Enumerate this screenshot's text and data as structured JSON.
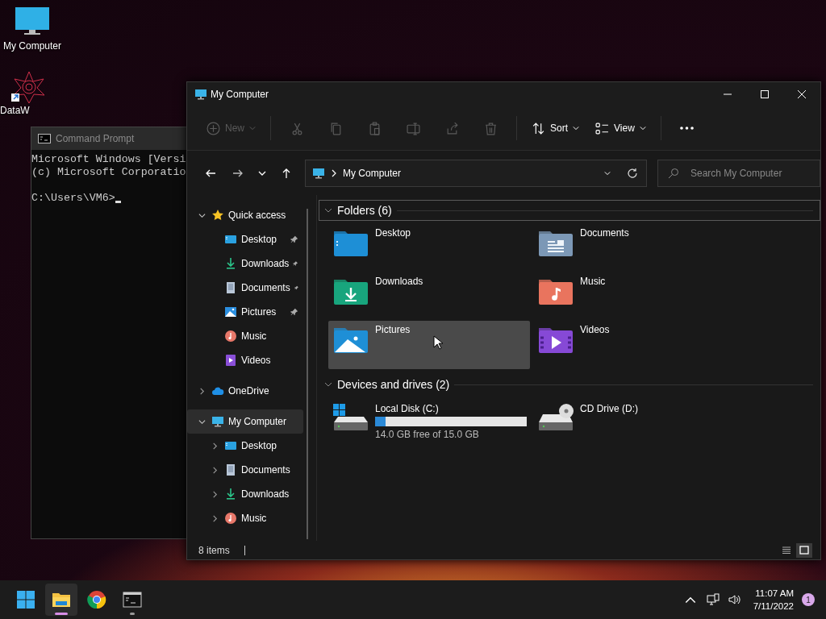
{
  "desktop_icons": [
    {
      "kind": "computer",
      "label": "My Computer"
    },
    {
      "kind": "shortcut",
      "label": "DataW"
    }
  ],
  "console": {
    "title": "Command Prompt",
    "lines": [
      "Microsoft Windows [Versi",
      "(c) Microsoft Corporatio"
    ],
    "prompt": "C:\\Users\\VM6>"
  },
  "explorer": {
    "title": "My Computer",
    "toolbar": [
      {
        "kind": "new",
        "label": "New",
        "disabled": true
      },
      {
        "kind": "cut",
        "disabled": true
      },
      {
        "kind": "copy",
        "disabled": true
      },
      {
        "kind": "paste",
        "disabled": true
      },
      {
        "kind": "rename",
        "disabled": true
      },
      {
        "kind": "share",
        "disabled": true
      },
      {
        "kind": "delete",
        "disabled": true
      },
      {
        "kind": "sort",
        "label": "Sort",
        "disabled": false
      },
      {
        "kind": "view",
        "label": "View",
        "disabled": false
      },
      {
        "kind": "more",
        "disabled": false
      }
    ],
    "address": {
      "path": "My Computer"
    },
    "search": {
      "placeholder": "Search My Computer"
    },
    "sidebar": [
      {
        "label": "Quick access",
        "kind": "star",
        "expanded": true,
        "selected": false,
        "children": [
          {
            "label": "Desktop",
            "kind": "desktop",
            "pinned": true,
            "selected": false
          },
          {
            "label": "Downloads",
            "kind": "downloads",
            "pinned": true,
            "selected": false
          },
          {
            "label": "Documents",
            "kind": "documents",
            "pinned": true,
            "selected": false
          },
          {
            "label": "Pictures",
            "kind": "pictures",
            "pinned": true,
            "selected": false
          },
          {
            "label": "Music",
            "kind": "music",
            "pinned": false,
            "selected": false
          },
          {
            "label": "Videos",
            "kind": "videos",
            "pinned": false,
            "selected": false
          }
        ]
      },
      {
        "label": "OneDrive",
        "kind": "cloud",
        "expanded": false,
        "selected": false
      },
      {
        "label": "My Computer",
        "kind": "computer",
        "expanded": true,
        "selected": true,
        "children": [
          {
            "label": "Desktop",
            "kind": "desktop",
            "expanded": false,
            "selected": false
          },
          {
            "label": "Documents",
            "kind": "documents",
            "expanded": false,
            "selected": false
          },
          {
            "label": "Downloads",
            "kind": "downloads",
            "expanded": false,
            "selected": false
          },
          {
            "label": "Music",
            "kind": "music",
            "expanded": false,
            "selected": false
          }
        ]
      }
    ],
    "groups": [
      {
        "title": "Folders (6)",
        "expanded": true,
        "focused": true,
        "items": [
          {
            "kind": "desktop",
            "label": "Desktop",
            "selected": false
          },
          {
            "kind": "documents",
            "label": "Documents",
            "selected": false
          },
          {
            "kind": "downloads",
            "label": "Downloads",
            "selected": false
          },
          {
            "kind": "music",
            "label": "Music",
            "selected": false
          },
          {
            "kind": "pictures",
            "label": "Pictures",
            "selected": true
          },
          {
            "kind": "videos",
            "label": "Videos",
            "selected": false
          }
        ]
      },
      {
        "title": "Devices and drives (2)",
        "expanded": true,
        "focused": false,
        "items": [
          {
            "kind": "system-disk",
            "label": "Local Disk (C:)",
            "level": 0.07,
            "detail": "14.0 GB free of 15.0 GB",
            "selected": false
          },
          {
            "kind": "cd-drive",
            "label": "CD Drive (D:)",
            "selected": false
          }
        ]
      }
    ],
    "status": {
      "count": "8 items"
    },
    "view_modes": [
      {
        "kind": "details",
        "selected": false
      },
      {
        "kind": "large-icons",
        "selected": true
      }
    ]
  },
  "taskbar": {
    "apps": [
      {
        "kind": "start",
        "running": false,
        "active": false
      },
      {
        "kind": "files",
        "running": true,
        "active": true
      },
      {
        "kind": "browser",
        "running": false,
        "active": false
      },
      {
        "kind": "terminal",
        "running": true,
        "active": false
      }
    ],
    "time": "11:07 AM",
    "date": "7/11/2022",
    "notifications": "1"
  }
}
